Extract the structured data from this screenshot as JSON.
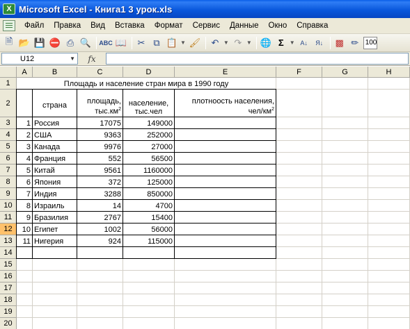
{
  "window": {
    "title": "Microsoft Excel - Книга1 3 урок.xls",
    "icon": "excel-app-icon"
  },
  "menu": [
    "Файл",
    "Правка",
    "Вид",
    "Вставка",
    "Формат",
    "Сервис",
    "Данные",
    "Окно",
    "Справка"
  ],
  "toolbar": {
    "icons": [
      "new-icon",
      "open-icon",
      "save-icon",
      "permission-icon",
      "print-icon",
      "print-preview-icon",
      "spelling-icon",
      "research-icon",
      "cut-icon",
      "copy-icon",
      "paste-icon",
      "format-painter-icon",
      "undo-icon",
      "redo-icon",
      "hyperlink-icon",
      "autosum-icon",
      "sort-ascending-icon",
      "sort-descending-icon",
      "chart-wizard-icon",
      "drawing-icon"
    ],
    "zoom": "100%"
  },
  "formula_bar": {
    "name_box": "U12",
    "fx_label": "fx",
    "formula": ""
  },
  "columns": [
    "A",
    "B",
    "C",
    "D",
    "E",
    "F",
    "G",
    "H"
  ],
  "rows": [
    "1",
    "2",
    "3",
    "4",
    "5",
    "6",
    "7",
    "8",
    "9",
    "10",
    "11",
    "12",
    "13",
    "14",
    "15",
    "16",
    "17",
    "18",
    "19",
    "20"
  ],
  "selected_row": "12",
  "sheet": {
    "title": "Площадь и население стран мира в 1990 году",
    "headers": {
      "country": "страна",
      "area": "площадь, тыс.км",
      "area_sup": "2",
      "population": "население, тыс.чел",
      "density": "плотноость населения, чел/км",
      "density_sup": "2"
    },
    "data": [
      {
        "n": "1",
        "country": "Россия",
        "area": "17075",
        "population": "149000"
      },
      {
        "n": "2",
        "country": "США",
        "area": "9363",
        "population": "252000"
      },
      {
        "n": "3",
        "country": "Канада",
        "area": "9976",
        "population": "27000"
      },
      {
        "n": "4",
        "country": "Франция",
        "area": "552",
        "population": "56500"
      },
      {
        "n": "5",
        "country": "Китай",
        "area": "9561",
        "population": "1160000"
      },
      {
        "n": "6",
        "country": "Япония",
        "area": "372",
        "population": "125000"
      },
      {
        "n": "7",
        "country": "Индия",
        "area": "3288",
        "population": "850000"
      },
      {
        "n": "8",
        "country": "Израиль",
        "area": "14",
        "population": "4700"
      },
      {
        "n": "9",
        "country": "Бразилия",
        "area": "2767",
        "population": "15400"
      },
      {
        "n": "10",
        "country": "Египет",
        "area": "1002",
        "population": "56000"
      },
      {
        "n": "11",
        "country": "Нигерия",
        "area": "924",
        "population": "115000"
      }
    ]
  }
}
